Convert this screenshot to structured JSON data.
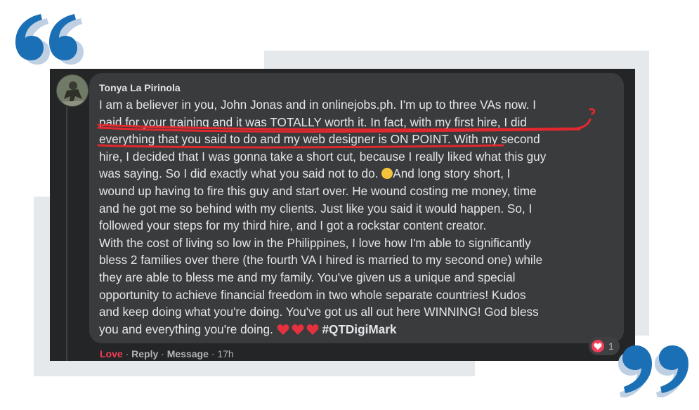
{
  "comment": {
    "author": "Tonya La Pirinola",
    "lines": [
      "I am a believer in you, John Jonas and in onlinejobs.ph. I'm up to three VAs now. I",
      "paid for your training and it was TOTALLY worth it. In fact, with my first hire, I did",
      "everything that you said to do and my web designer is ON POINT. With my second",
      "hire, I decided that I was gonna take a short cut, because I really liked what this guy",
      "was saying. So I did exactly what you said not to do.",
      "And long story short, I",
      "wound up having to fire this guy and start over. He wound costing me money, time",
      "and he got me so behind with my clients. Just like you said it would happen. So, I",
      "followed your steps for my third hire, and I got a rockstar content creator.",
      "With the cost of living so low in the Philippines, I love how I'm able to significantly",
      "bless 2 families over there (the fourth VA I hired is married to my second one) while",
      "they are able to bless me and my family. You've given us a unique and special",
      "opportunity to achieve financial freedom in two whole separate countries! Kudos",
      "and keep doing what you're doing. You've got us all out here WINNING! God bless",
      "you and everything you're doing."
    ],
    "hashtag": "#QTDigiMark"
  },
  "actions": {
    "love": "Love",
    "reply": "Reply",
    "message": "Message",
    "time": "17h",
    "separator": " · "
  },
  "reactions": {
    "count": "1",
    "icon": "heart-icon"
  },
  "colors": {
    "accent": "#1a6fb5",
    "quote_shadow": "#bfd0e3",
    "underline": "#e0282e",
    "love": "#f33e58",
    "card_bg": "#242526",
    "bubble_bg": "#3a3b3c"
  },
  "emoji": [
    "rolling-eyes-emoji",
    "heart-emoji",
    "heart-emoji",
    "heart-emoji"
  ]
}
